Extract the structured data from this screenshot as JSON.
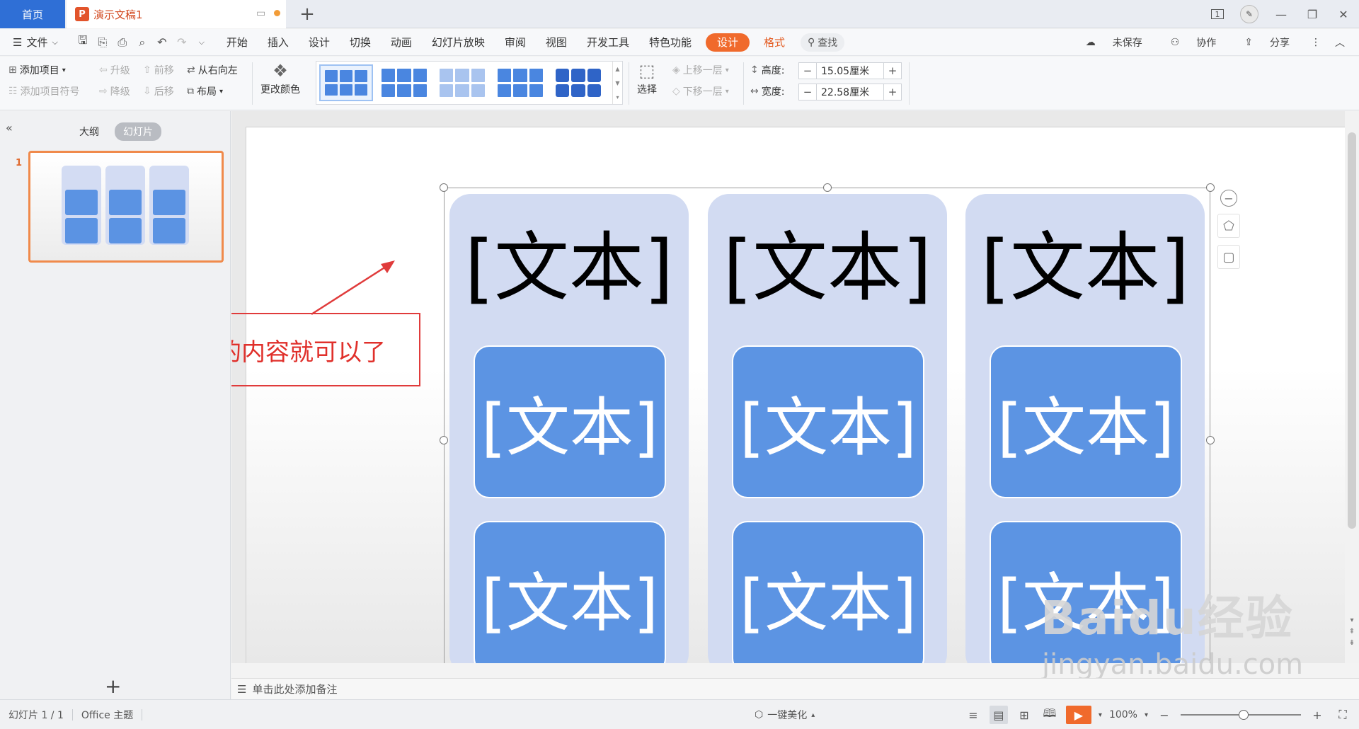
{
  "tabs": {
    "home": "首页",
    "doc_icon": "P",
    "doc_title": "演示文稿1",
    "new_tab": "+"
  },
  "window": {
    "page_indicator": "1"
  },
  "menu": {
    "file": "文件",
    "items": [
      "开始",
      "插入",
      "设计",
      "切换",
      "动画",
      "幻灯片放映",
      "审阅",
      "视图",
      "开发工具",
      "特色功能"
    ],
    "design_tab": "设计",
    "format_tab": "格式",
    "search": "查找",
    "unsaved": "未保存",
    "collaborate": "协作",
    "share": "分享"
  },
  "ribbon": {
    "add_item": "添加项目",
    "add_bullet": "添加项目符号",
    "promote": "升级",
    "demote": "降级",
    "move_up": "前移",
    "move_down": "后移",
    "right_to_left": "从右向左",
    "layout": "布局",
    "change_color": "更改颜色",
    "select": "选择",
    "bring_forward": "上移一层",
    "send_backward": "下移一层",
    "height_label": "高度:",
    "height_value": "15.05厘米",
    "width_label": "宽度:",
    "width_value": "22.58厘米"
  },
  "left_panel": {
    "outline_tab": "大纲",
    "slides_tab": "幻灯片",
    "slide_number": "1"
  },
  "slide": {
    "column_title": "[文本]",
    "box_text": "[文本]",
    "annotation": "编辑需要的内容就可以了",
    "accent_color": "#5c94e3",
    "column_bg": "#d2dbf2",
    "annotation_color": "#e0302b"
  },
  "notes": {
    "placeholder": "单击此处添加备注"
  },
  "status": {
    "slide_count": "幻灯片 1 / 1",
    "theme": "Office 主题",
    "beautify": "一键美化",
    "zoom": "100%"
  },
  "watermark": {
    "brand": "Baidu经验",
    "url": "jingyan.baidu.com"
  }
}
